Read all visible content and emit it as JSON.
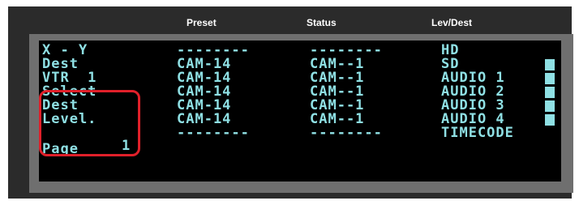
{
  "headers": [
    "Preset",
    "Status",
    "Lev/Dest"
  ],
  "rows": [
    {
      "label": "X - Y",
      "preset": "--------",
      "status": "--------",
      "lev": "HD"
    },
    {
      "label": "Dest",
      "preset": "CAM-14",
      "status": "CAM--1",
      "lev": "SD"
    },
    {
      "label": "VTR  1",
      "preset": "CAM-14",
      "status": "CAM--1",
      "lev": "AUDIO 1"
    },
    {
      "label": "Select",
      "preset": "CAM-14",
      "status": "CAM--1",
      "lev": "AUDIO 2"
    },
    {
      "label": "Dest",
      "preset": "CAM-14",
      "status": "CAM--1",
      "lev": "AUDIO 3"
    },
    {
      "label": "Level.",
      "preset": "CAM-14",
      "status": "CAM--1",
      "lev": "AUDIO 4"
    },
    {
      "label": "",
      "preset": "--------",
      "status": "--------",
      "lev": "TIMECODE"
    }
  ],
  "page": {
    "label": "Page",
    "number": "1"
  },
  "colors": {
    "text": "#8fe0e4",
    "highlight": "#e0202a",
    "bezel": "#6f6f6f"
  },
  "level_indicators": [
    {
      "level": "SD",
      "selected": true
    },
    {
      "level": "AUDIO 1",
      "selected": true
    },
    {
      "level": "AUDIO 2",
      "selected": true
    },
    {
      "level": "AUDIO 3",
      "selected": true
    },
    {
      "level": "AUDIO 4",
      "selected": true
    }
  ]
}
